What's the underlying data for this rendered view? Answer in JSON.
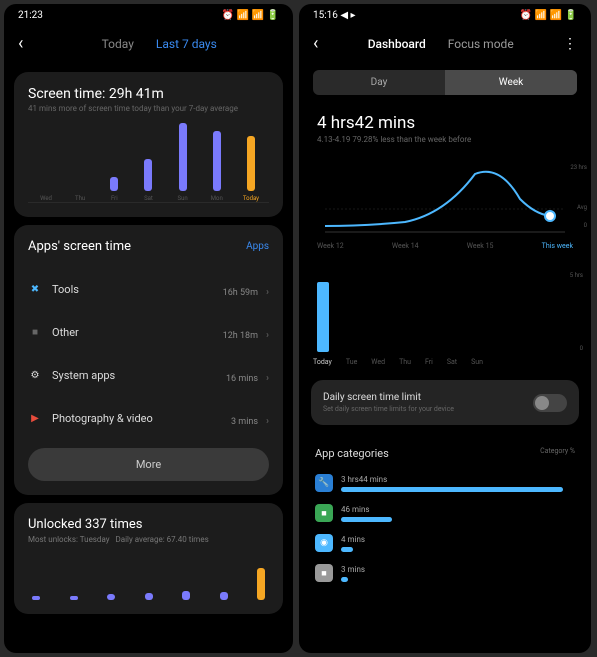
{
  "left": {
    "status": {
      "time": "21:23",
      "icons": "⏰ 📶 📶 🔋"
    },
    "tabs": {
      "today": "Today",
      "last7": "Last 7 days"
    },
    "screentime": {
      "title": "Screen time: 29h 41m",
      "sub": "41 mins more of screen time today than your 7-day average"
    },
    "apps": {
      "title": "Apps' screen time",
      "link": "Apps",
      "rows": [
        {
          "icon": "✖",
          "iconColor": "#4db8ff",
          "name": "Tools",
          "time": "16h 59m"
        },
        {
          "icon": "■",
          "iconColor": "#666",
          "name": "Other",
          "time": "12h 18m"
        },
        {
          "icon": "⚙",
          "iconColor": "#ddd",
          "name": "System apps",
          "time": "16 mins"
        },
        {
          "icon": "▶",
          "iconColor": "#e74c3c",
          "name": "Photography & video",
          "time": "3 mins"
        }
      ],
      "more": "More"
    },
    "unlock": {
      "title": "Unlocked 337 times",
      "sub_most": "Most unlocks: Tuesday",
      "sub_avg": "Daily average: 67.40 times"
    }
  },
  "right": {
    "status": {
      "time": "15:16 ◀ ▸",
      "icons": "⏰ 📶 📶 🔋"
    },
    "tabs": {
      "dashboard": "Dashboard",
      "focus": "Focus mode"
    },
    "segment": {
      "day": "Day",
      "week": "Week"
    },
    "big": {
      "time": "4 hrs42 mins",
      "sub": "4.13-4.19  79.28% less than the week before"
    },
    "limit": {
      "title": "Daily screen time limit",
      "sub": "Set daily screen time limits for your device"
    },
    "categories": {
      "title": "App categories",
      "sub": "Category  %",
      "rows": [
        {
          "iconBg": "#2a7fd4",
          "icon": "🔧",
          "time": "3 hrs44 mins",
          "pct": 95
        },
        {
          "iconBg": "#3aa655",
          "icon": "■",
          "time": "46 mins",
          "pct": 22
        },
        {
          "iconBg": "#4db8ff",
          "icon": "◉",
          "time": "4 mins",
          "pct": 5
        },
        {
          "iconBg": "#999",
          "icon": "■",
          "time": "3 mins",
          "pct": 3
        }
      ]
    }
  },
  "chart_data": [
    {
      "type": "bar",
      "title": "Screen time last 7 days",
      "categories": [
        "Wed",
        "Thu",
        "Fri",
        "Sat",
        "Sun",
        "Mon",
        "Today"
      ],
      "values": [
        0,
        0,
        14,
        32,
        68,
        60,
        55
      ],
      "highlight_index": 6,
      "colors": {
        "default": "#7a7afc",
        "highlight": "#f5a623"
      }
    },
    {
      "type": "line",
      "title": "Weekly usage trend",
      "categories": [
        "Week 12",
        "Week 14",
        "Week 15",
        "This week"
      ],
      "values": [
        2,
        3,
        22,
        5
      ],
      "ylabel": "hrs",
      "ylim": [
        0,
        23
      ],
      "highlight_index": 3,
      "annotations": [
        "23 hrs",
        "Avg",
        "0"
      ]
    },
    {
      "type": "bar",
      "title": "Daily usage this week",
      "categories": [
        "Today",
        "Tue",
        "Wed",
        "Thu",
        "Fri",
        "Sat",
        "Sun"
      ],
      "values": [
        4.7,
        0,
        0,
        0,
        0,
        0,
        0
      ],
      "ylabel": "hrs",
      "ylim": [
        0,
        5
      ],
      "colors": {
        "default": "#4db8ff"
      }
    },
    {
      "type": "bar",
      "title": "Unlocks last 7 days",
      "categories": [
        "Wed",
        "Thu",
        "Fri",
        "Sat",
        "Sun",
        "Mon",
        "Today"
      ],
      "values": [
        4,
        4,
        6,
        7,
        9,
        8,
        32
      ],
      "highlight_index": 6,
      "colors": {
        "default": "#7a7afc",
        "highlight": "#f5a623"
      }
    }
  ]
}
